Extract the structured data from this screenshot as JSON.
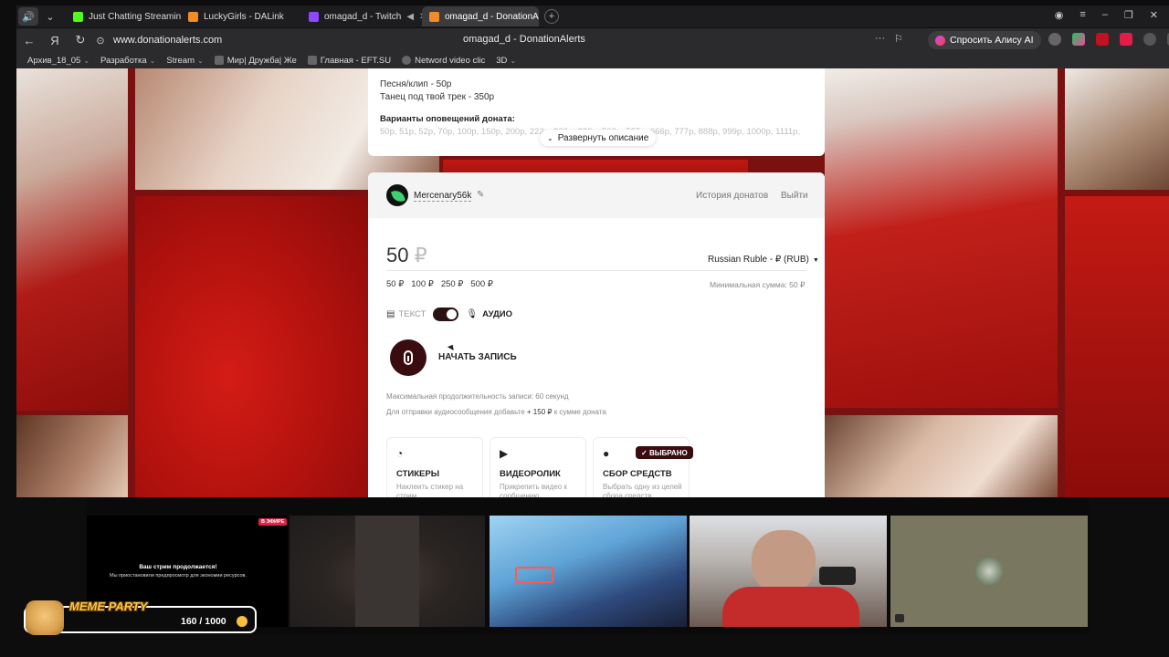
{
  "browser": {
    "tabs": [
      {
        "title": "Just Chatting Streaming - I",
        "favicon_color": "#53fc18",
        "active": false
      },
      {
        "title": "LuckyGirls - DALink",
        "favicon_color": "#f28b29",
        "active": false
      },
      {
        "title": "omagad_d - Twitch",
        "favicon_color": "#9146ff",
        "active": false,
        "audio": true
      },
      {
        "title": "omagad_d - DonationAl",
        "favicon_color": "#f28b29",
        "active": true
      }
    ],
    "url": "www.donationalerts.com",
    "page_title": "omagad_d - DonationAlerts",
    "alisa_button": "Спросить Алису AI",
    "bookmarks": [
      {
        "label": "Архив_18_05",
        "has_menu": true
      },
      {
        "label": "Разработка",
        "has_menu": true
      },
      {
        "label": "Stream",
        "has_menu": true
      },
      {
        "label": "Мир| Дружба| Же",
        "has_menu": false
      },
      {
        "label": "Главная - EFT.SU",
        "has_menu": false
      },
      {
        "label": "Netword video clic",
        "has_menu": false
      },
      {
        "label": "3D",
        "has_menu": true
      }
    ]
  },
  "description": {
    "lines": [
      "Песня/клип - 50р",
      "Танец под твой трек - 350р"
    ],
    "alerts_heading": "Варианты оповещений доната:",
    "alerts_values": "50р, 51р, 52р, 70р, 100р, 150р, 200р, 222р, 300р, 333р, 500р, 555р, 666р, 777р, 888р, 999р, 1000р, 1111р,",
    "expand_label": "Развернуть описание"
  },
  "donation_form": {
    "username": "Mercenary56k",
    "history_link": "История донатов",
    "logout_link": "Выйти",
    "amount": "50",
    "currency_symbol": "₽",
    "currency_select": "Russian Ruble - ₽ (RUB)",
    "presets": [
      "50 ₽",
      "100 ₽",
      "250 ₽",
      "500 ₽"
    ],
    "min_sum": "Минимальная сумма: 50 ₽",
    "mode_text": "ТЕКСТ",
    "mode_audio": "АУДИО",
    "audio_enabled": true,
    "record_label": "НАЧАТЬ ЗАПИСЬ",
    "max_duration_hint": "Максимальная продолжительность записи: 60 секунд",
    "audio_fee_prefix": "Для отправки аудиосообщения добавьте",
    "audio_fee_amount": "+ 150 ₽",
    "audio_fee_suffix": "к сумме доната",
    "options": [
      {
        "title": "СТИКЕРЫ",
        "desc": "Наклеить стикер на стрим",
        "icon": "sticker-icon"
      },
      {
        "title": "ВИДЕОРОЛИК",
        "desc": "Прикрепить видео к сообщению",
        "icon": "play-icon"
      },
      {
        "title": "СБОР СРЕДСТВ",
        "desc": "Выбрать одну из целей сбора средств",
        "icon": "money-bag-icon",
        "badge": "ВЫБРАНО"
      }
    ]
  },
  "stream_overlay": {
    "live_badge": "В ЭФИРЕ",
    "preview_title": "Ваш стрим продолжается!",
    "preview_subtitle": "Мы приостановили предпросмотр для экономии ресурсов.",
    "meme_label": "MEME PARTY",
    "meme_progress": "160 / 1000",
    "meme_progress_fraction": 0.16
  }
}
